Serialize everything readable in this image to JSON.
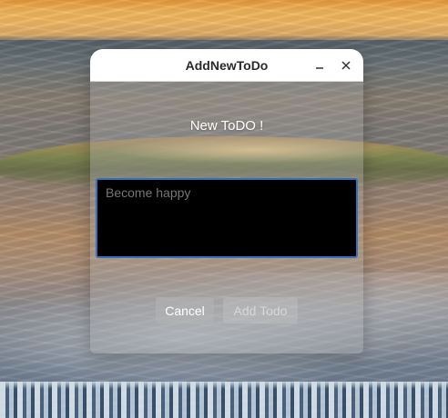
{
  "dialog": {
    "title": "AddNewToDo",
    "heading": "New ToDO !",
    "input": {
      "placeholder": "Become happy",
      "value": ""
    },
    "buttons": {
      "cancel": "Cancel",
      "add": "Add Todo"
    }
  },
  "window_controls": {
    "minimize_icon": "minimize-icon",
    "close_icon": "close-icon"
  },
  "colors": {
    "input_border": "#3a6fb8",
    "input_bg": "#000000",
    "titlebar_bg": "#ffffff"
  },
  "background": "ocean-sunset-wallpaper"
}
